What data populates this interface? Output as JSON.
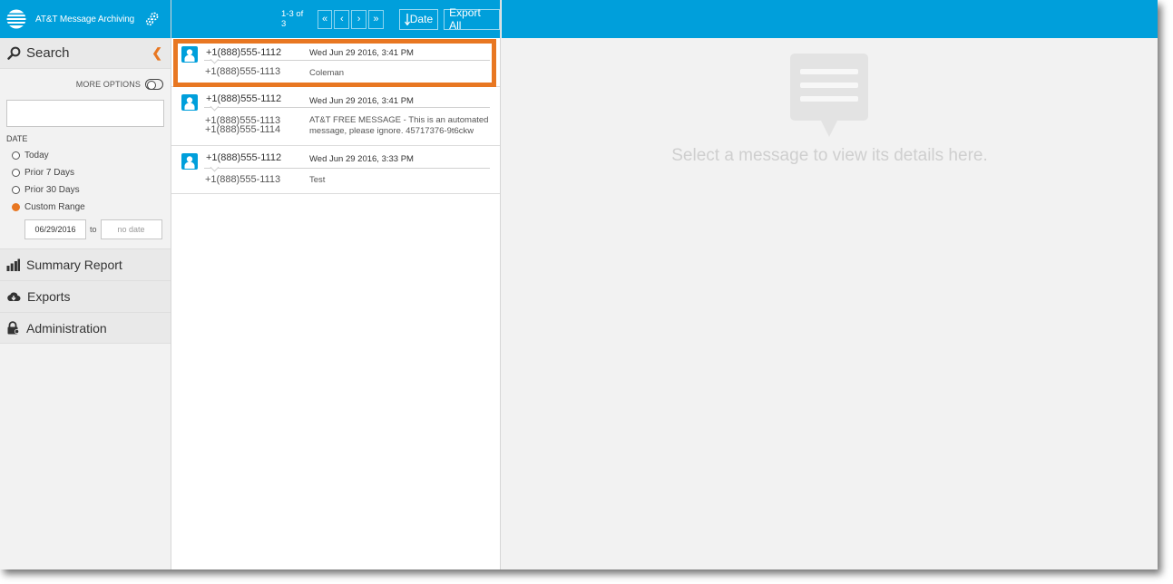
{
  "app": {
    "title": "AT&T Message Archiving"
  },
  "sidebar": {
    "search_label": "Search",
    "more_options_label": "MORE OPTIONS",
    "search_input": {
      "value": "",
      "placeholder": ""
    },
    "date_label": "DATE",
    "date_options": [
      {
        "label": "Today",
        "selected": false
      },
      {
        "label": "Prior 7 Days",
        "selected": false
      },
      {
        "label": "Prior 30 Days",
        "selected": false
      },
      {
        "label": "Custom Range",
        "selected": true
      }
    ],
    "range": {
      "from_value": "06/29/2016",
      "to_label": "to",
      "to_placeholder": "no date"
    },
    "nav": [
      {
        "label": "Summary Report",
        "icon": "bar-chart-icon"
      },
      {
        "label": "Exports",
        "icon": "cloud-download-icon"
      },
      {
        "label": "Administration",
        "icon": "lock-icon"
      }
    ]
  },
  "toolbar": {
    "count": "1-3 of 3",
    "first_page": "«",
    "prev_page": "‹",
    "next_page": "›",
    "last_page": "»",
    "sort_date_label": "Date",
    "export_all_label": "Export All"
  },
  "messages": [
    {
      "from": "+1(888)555-1112",
      "date": "Wed Jun 29 2016, 3:41 PM",
      "to": [
        "+1(888)555-1113"
      ],
      "body": "Coleman",
      "selected": true
    },
    {
      "from": "+1(888)555-1112",
      "date": "Wed Jun 29 2016, 3:41 PM",
      "to": [
        "+1(888)555-1113",
        "+1(888)555-1114"
      ],
      "body": "AT&T FREE MESSAGE - This is an automated message, please ignore. 45717376-9t6ckw",
      "selected": false
    },
    {
      "from": "+1(888)555-1112",
      "date": "Wed Jun 29 2016, 3:33 PM",
      "to": [
        "+1(888)555-1113"
      ],
      "body": "Test",
      "selected": false
    }
  ],
  "detail": {
    "empty_text": "Select a message to view its details here."
  },
  "colors": {
    "brand_blue": "#009fdb",
    "accent_orange": "#e87722",
    "panel_gray": "#f2f2f2"
  }
}
